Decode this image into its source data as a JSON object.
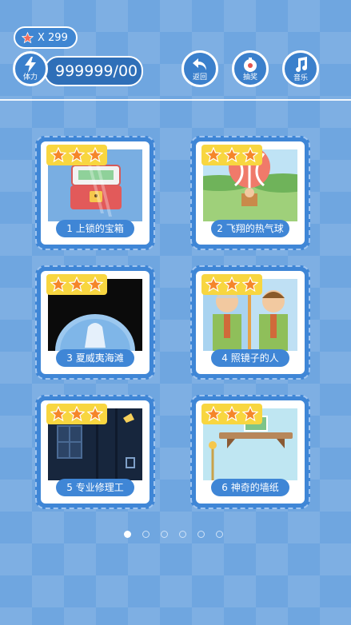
{
  "header": {
    "star_count": "X 299",
    "energy_value": "999999/",
    "energy_suffix": "00",
    "energy_label": "体力",
    "buttons": [
      {
        "label": "返回",
        "icon": "back-arrow-icon"
      },
      {
        "label": "抽奖",
        "icon": "lottery-icon"
      },
      {
        "label": "音乐",
        "icon": "music-note-icon"
      }
    ]
  },
  "levels": [
    {
      "label": "1 上锁的宝箱",
      "stars": 3
    },
    {
      "label": "2 飞翔的热气球",
      "stars": 3
    },
    {
      "label": "3 夏威夷海滩",
      "stars": 3
    },
    {
      "label": "4 照镜子的人",
      "stars": 3
    },
    {
      "label": "5 专业修理工",
      "stars": 3
    },
    {
      "label": "6 神奇的墙纸",
      "stars": 3
    }
  ],
  "pagination": {
    "pages": 6,
    "current": 1
  },
  "colors": {
    "accent": "#3f86d6",
    "star": "#f5862a",
    "star_bar": "#f8d640"
  }
}
